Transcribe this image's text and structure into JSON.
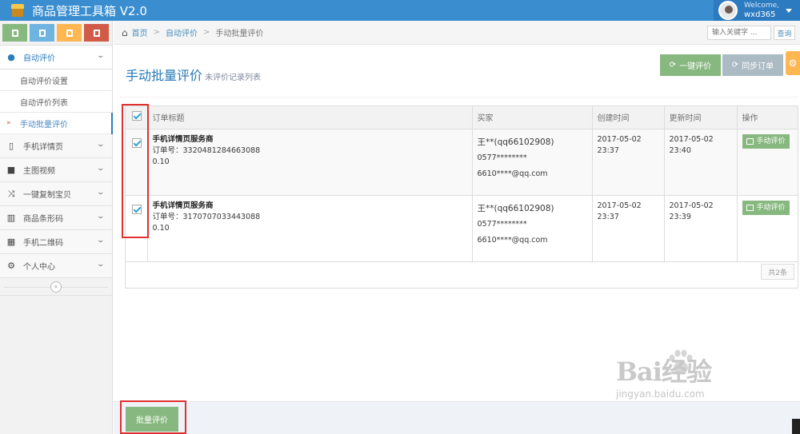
{
  "app": {
    "title": "商品管理工具箱 V2.0"
  },
  "user": {
    "greeting": "Welcome,",
    "name": "wxd365"
  },
  "shortcuts": [
    "shortcut-1",
    "shortcut-2",
    "shortcut-3",
    "shortcut-4"
  ],
  "sidebar": {
    "items": [
      {
        "label": "自动评价",
        "icon": "chat-bubble-icon",
        "open": true,
        "children": [
          "自动评价设置",
          "自动评价列表",
          "手动批量评价"
        ]
      },
      {
        "label": "手机详情页",
        "icon": "tablet-icon"
      },
      {
        "label": "主图视频",
        "icon": "video-camera-icon"
      },
      {
        "label": "一键复制宝贝",
        "icon": "shuffle-icon"
      },
      {
        "label": "商品条形码",
        "icon": "barcode-icon"
      },
      {
        "label": "手机二维码",
        "icon": "qrcode-icon"
      },
      {
        "label": "个人中心",
        "icon": "gear-icon"
      }
    ],
    "collapse": "«"
  },
  "breadcrumb": {
    "home": "首页",
    "parent": "自动评价",
    "current": "手动批量评价"
  },
  "search": {
    "placeholder": "输入关键字 ...",
    "button": "查询"
  },
  "page": {
    "title": "手动批量评价",
    "subtitle": "未评价记录列表"
  },
  "toolbar": {
    "onekey": "一键评价",
    "sync": "同步订单"
  },
  "table": {
    "headers": [
      "订单标题",
      "买家",
      "创建时间",
      "更新时间",
      "操作"
    ],
    "rows": [
      {
        "title": "手机详情页服务商",
        "order": "订单号：3320481284663088",
        "amount": "0.10",
        "buyer": "王**(qq66102908)",
        "phone": "0577********",
        "email": "6610****@qq.com",
        "created_date": "2017-05-02",
        "created_time": "23:37",
        "updated_date": "2017-05-02",
        "updated_time": "23:40",
        "action": "手动评价",
        "checked": true
      },
      {
        "title": "手机详情页服务商",
        "order": "订单号：3170707033443088",
        "amount": "0.10",
        "buyer": "王**(qq66102908)",
        "phone": "0577********",
        "email": "6610****@qq.com",
        "created_date": "2017-05-02",
        "created_time": "23:37",
        "updated_date": "2017-05-02",
        "updated_time": "23:39",
        "action": "手动评价",
        "checked": true
      }
    ],
    "total": "共2条"
  },
  "footer": {
    "batch_button": "批量评价"
  },
  "watermark": {
    "brand": "Bai经验",
    "url": "jingyan.baidu.com"
  },
  "colors": {
    "navbar": "#3a8ed0",
    "green_button": "#87b87f",
    "gray_button": "#abbac3",
    "orange": "#ffb752",
    "highlight": "#e03030"
  }
}
